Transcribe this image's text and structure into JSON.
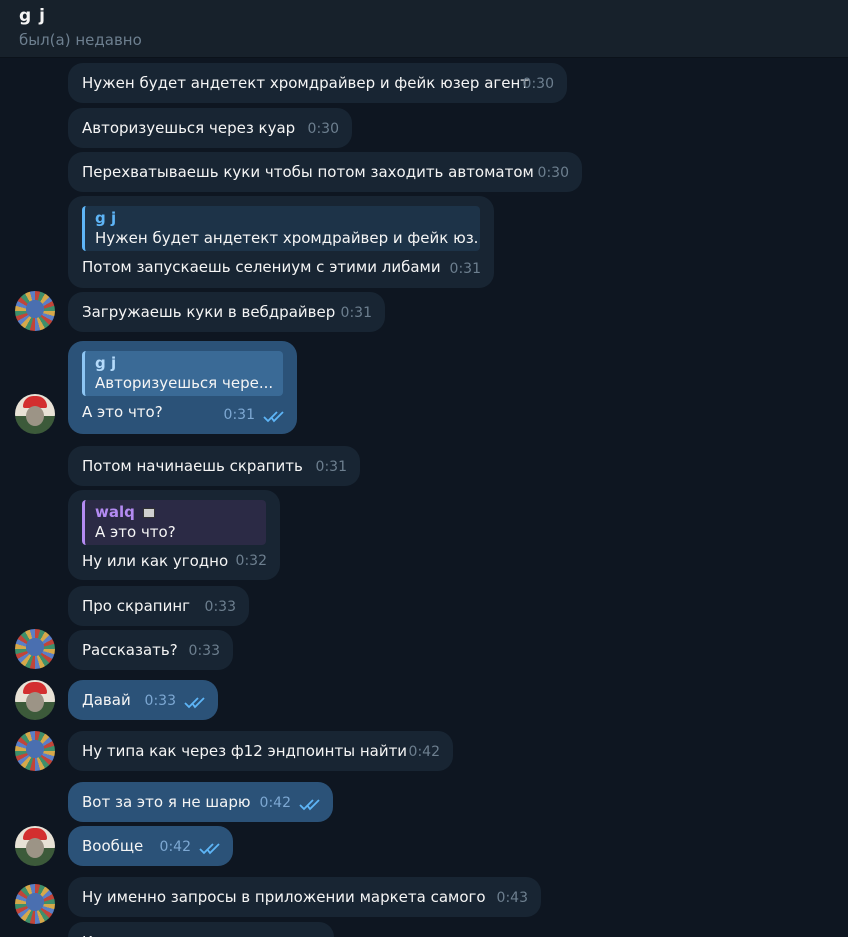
{
  "header": {
    "title": "g j",
    "status": "был(а) недавно"
  },
  "messages": [
    {
      "text": "Нужен будет андетект хромдрайвер и фейк юзер агент",
      "time": "0:30"
    },
    {
      "text": "Авторизуешься через куар",
      "time": "0:30"
    },
    {
      "text": "Перехватываешь куки чтобы потом заходить автоматом",
      "time": "0:30"
    },
    {
      "reply_name": "g j",
      "reply_text": "Нужен будет андетект хромдрайвер и фейк юз...",
      "text": "Потом запускаешь селениум с этими либами",
      "time": "0:31"
    },
    {
      "text": "Загружаешь куки в вебдрайвер",
      "time": "0:31"
    },
    {
      "reply_name": "g j",
      "reply_text": "Авторизуешься чере...",
      "text": "А это что?",
      "time": "0:31"
    },
    {
      "text": "Потом начинаешь скрапить",
      "time": "0:31"
    },
    {
      "reply_name": "walq",
      "reply_text": "А это что?",
      "text": "Ну или как угодно",
      "time": "0:32"
    },
    {
      "text": "Про скрапинг",
      "time": "0:33"
    },
    {
      "text": "Рассказать?",
      "time": "0:33"
    },
    {
      "text": "Давай",
      "time": "0:33"
    },
    {
      "text": "Ну типа как через ф12 эндпоинты найти",
      "time": "0:42"
    },
    {
      "text": "Вот за это я не шарю",
      "time": "0:42"
    },
    {
      "text": "Вообще",
      "time": "0:42"
    },
    {
      "text": "Ну именно запросы в приложении маркета самого",
      "time": "0:43"
    },
    {
      "text": "К",
      "time": ""
    }
  ],
  "colors": {
    "background": "#0e1621",
    "incoming": "#182533",
    "outgoing": "#2b5278",
    "accent": "#5eb5f7"
  },
  "icons": {
    "read_receipt": "double-check-icon",
    "reply_emoji": "emoji-icon"
  }
}
